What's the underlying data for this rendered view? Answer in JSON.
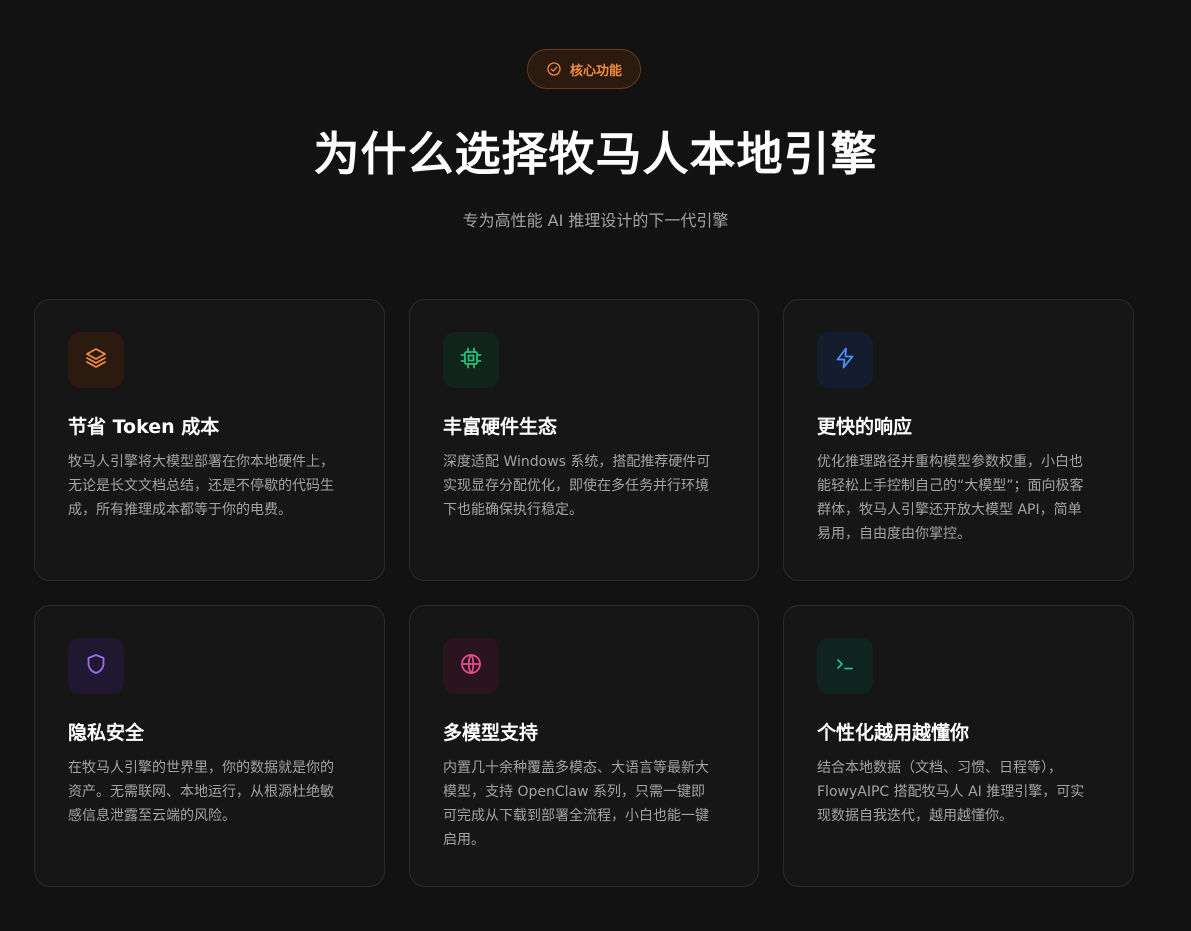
{
  "badge": {
    "label": "核心功能",
    "icon": "check-circle-icon",
    "color": "#f28a3c"
  },
  "hero": {
    "title": "为什么选择牧马人本地引擎",
    "subtitle": "专为高性能 AI 推理设计的下一代引擎"
  },
  "features": [
    {
      "title": "节省 Token 成本",
      "description": "牧马人引擎将大模型部署在你本地硬件上，无论是长文文档总结，还是不停歇的代码生成，所有推理成本都等于你的电费。",
      "icon": "layers-icon",
      "accent": "#f28a3c"
    },
    {
      "title": "丰富硬件生态",
      "description": "深度适配 Windows 系统，搭配推荐硬件可实现显存分配优化，即使在多任务并行环境下也能确保执行稳定。",
      "icon": "cpu-chip-icon",
      "accent": "#22c07a"
    },
    {
      "title": "更快的响应",
      "description": "优化推理路径并重构模型参数权重，小白也能轻松上手控制自己的“大模型”；面向极客群体，牧马人引擎还开放大模型 API，简单易用，自由度由你掌控。",
      "icon": "lightning-bolt-icon",
      "accent": "#4d8ff7"
    },
    {
      "title": "隐私安全",
      "description": "在牧马人引擎的世界里，你的数据就是你的资产。无需联网、本地运行，从根源杜绝敏感信息泄露至云端的风险。",
      "icon": "shield-icon",
      "accent": "#9b6cf2"
    },
    {
      "title": "多模型支持",
      "description": "内置几十余种覆盖多模态、大语言等最新大模型，支持 OpenClaw 系列，只需一键即可完成从下载到部署全流程，小白也能一键启用。",
      "icon": "globe-icon",
      "accent": "#e64c8f"
    },
    {
      "title": "个性化越用越懂你",
      "description": "结合本地数据（文档、习惯、日程等），FlowyAIPC 搭配牧马人 AI 推理引擎，可实现数据自我迭代，越用越懂你。",
      "icon": "terminal-icon",
      "accent": "#1fb8a0"
    }
  ]
}
